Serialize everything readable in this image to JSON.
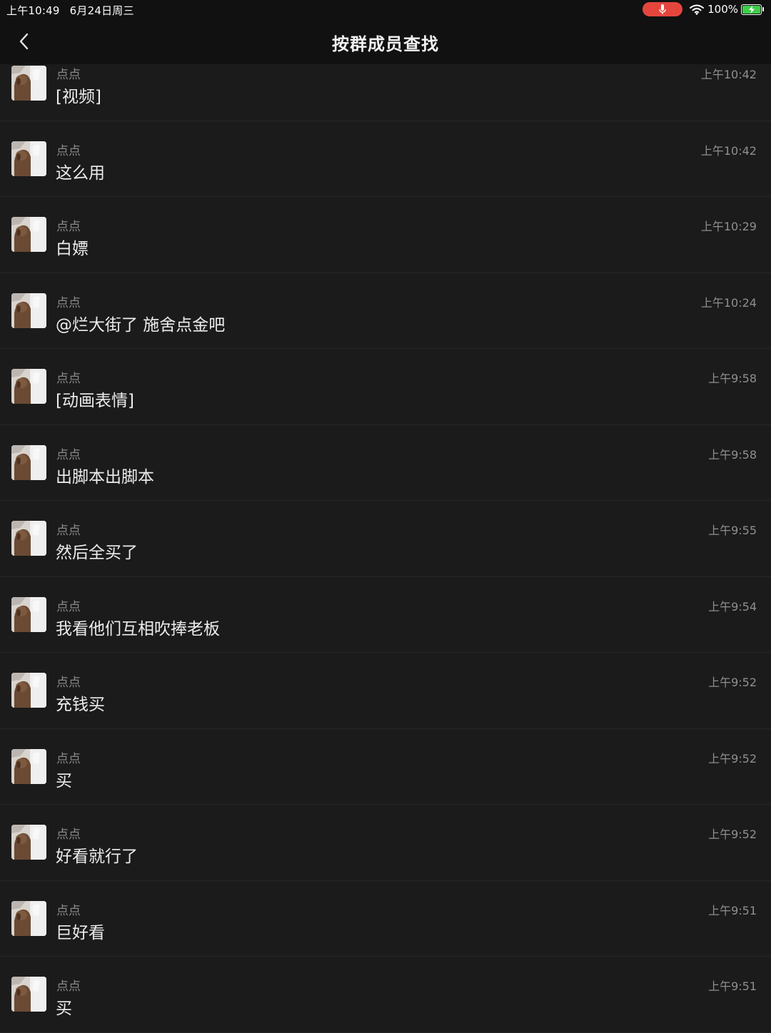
{
  "status_bar": {
    "time": "上午10:49",
    "date": "6月24日周三",
    "battery": "100%",
    "icons": [
      "microphone-icon",
      "wifi-icon",
      "battery-charging-icon"
    ],
    "mic_color": "#e4463d",
    "battery_color": "#3ecf4a"
  },
  "nav": {
    "title": "按群成员查找",
    "back_icon": "chevron-left-icon"
  },
  "messages": [
    {
      "sender": "点点",
      "text": "[视频]",
      "time": "上午10:42"
    },
    {
      "sender": "点点",
      "text": "这么用",
      "time": "上午10:42"
    },
    {
      "sender": "点点",
      "text": "白嫖",
      "time": "上午10:29"
    },
    {
      "sender": "点点",
      "text": "@烂大街了 施舍点金吧",
      "time": "上午10:24"
    },
    {
      "sender": "点点",
      "text": "[动画表情]",
      "time": "上午9:58"
    },
    {
      "sender": "点点",
      "text": "出脚本出脚本",
      "time": "上午9:58"
    },
    {
      "sender": "点点",
      "text": "然后全买了",
      "time": "上午9:55"
    },
    {
      "sender": "点点",
      "text": "我看他们互相吹捧老板",
      "time": "上午9:54"
    },
    {
      "sender": "点点",
      "text": "充钱买",
      "time": "上午9:52"
    },
    {
      "sender": "点点",
      "text": "买",
      "time": "上午9:52"
    },
    {
      "sender": "点点",
      "text": "好看就行了",
      "time": "上午9:52"
    },
    {
      "sender": "点点",
      "text": "巨好看",
      "time": "上午9:51"
    },
    {
      "sender": "点点",
      "text": "买",
      "time": "上午9:51"
    }
  ]
}
